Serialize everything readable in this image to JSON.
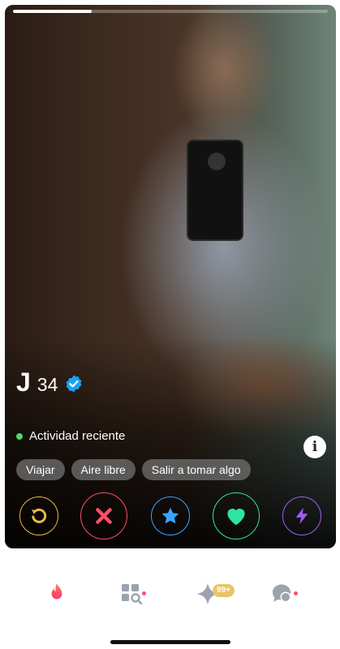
{
  "profile": {
    "name": "J",
    "age": "34",
    "verified": true,
    "activity": "Actividad reciente",
    "photo_progress": 0.25,
    "interests": [
      "Viajar",
      "Aire libre",
      "Salir a tomar algo"
    ]
  },
  "info_button": {
    "icon": "info-icon",
    "label": "i"
  },
  "actions": [
    {
      "name": "rewind",
      "icon": "rewind-icon",
      "color": "#e9b949"
    },
    {
      "name": "nope",
      "icon": "close-icon",
      "color": "#fd5068"
    },
    {
      "name": "super-like",
      "icon": "star-icon",
      "color": "#3ca4ff"
    },
    {
      "name": "like",
      "icon": "heart-icon",
      "color": "#2ee5a0"
    },
    {
      "name": "boost",
      "icon": "bolt-icon",
      "color": "#a35cf3"
    }
  ],
  "tabbar": {
    "tabs": [
      {
        "name": "swipe",
        "icon": "flame-icon",
        "active": true
      },
      {
        "name": "explore",
        "icon": "explore-grid-icon",
        "has_dot": true
      },
      {
        "name": "likes",
        "icon": "sparkle-icon",
        "badge": "99+"
      },
      {
        "name": "messages",
        "icon": "chat-icon",
        "has_dot": true
      }
    ]
  },
  "colors": {
    "brand": "#fd5068",
    "online": "#4cd964",
    "badge": "#e9c46a",
    "verified": "#1da1f2"
  }
}
